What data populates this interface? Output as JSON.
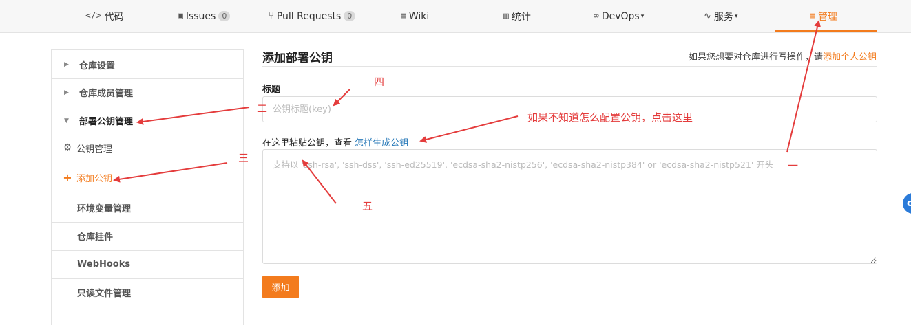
{
  "nav": {
    "tabs": [
      {
        "icon": "</>",
        "label": "代码"
      },
      {
        "icon": "▣",
        "label": "Issues",
        "count": "0"
      },
      {
        "icon": "⑂",
        "label": "Pull Requests",
        "count": "0"
      },
      {
        "icon": "▤",
        "label": "Wiki"
      },
      {
        "icon": "▥",
        "label": "统计"
      },
      {
        "icon": "∞",
        "label": "DevOps",
        "caret": "▾"
      },
      {
        "icon": "∿",
        "label": "服务",
        "caret": "▾"
      },
      {
        "icon": "▤",
        "label": "管理"
      }
    ],
    "active_color": "#f37b1d"
  },
  "sidebar": {
    "items": [
      {
        "label": "仓库设置"
      },
      {
        "label": "仓库成员管理"
      },
      {
        "label": "部署公钥管理"
      },
      {
        "label": "环境变量管理"
      },
      {
        "label": "仓库挂件"
      },
      {
        "label": "WebHooks"
      },
      {
        "label": "只读文件管理"
      }
    ],
    "sub_items": [
      {
        "icon": "gear-icon",
        "label": "公钥管理"
      },
      {
        "icon": "plus-icon",
        "label": "添加公钥"
      }
    ]
  },
  "main": {
    "title": "添加部署公钥",
    "hint_text": "如果您想要对仓库进行写操作，请",
    "hint_link": "添加个人公钥",
    "title_label": "标题",
    "title_placeholder": "公钥标题(key)",
    "key_label": "在这里粘贴公钥，查看",
    "key_link": "怎样生成公钥",
    "key_placeholder": "支持以 'ssh-rsa', 'ssh-dss', 'ssh-ed25519', 'ecdsa-sha2-nistp256', 'ecdsa-sha2-nistp384' or 'ecdsa-sha2-nistp521' 开头",
    "submit_label": "添加"
  },
  "annotations": {
    "one": "一",
    "two": "二",
    "three": "三",
    "four": "四",
    "five": "五",
    "tip": "如果不知道怎么配置公钥，点击这里",
    "color": "#e43c3c"
  },
  "float_button": {
    "label": "o"
  }
}
